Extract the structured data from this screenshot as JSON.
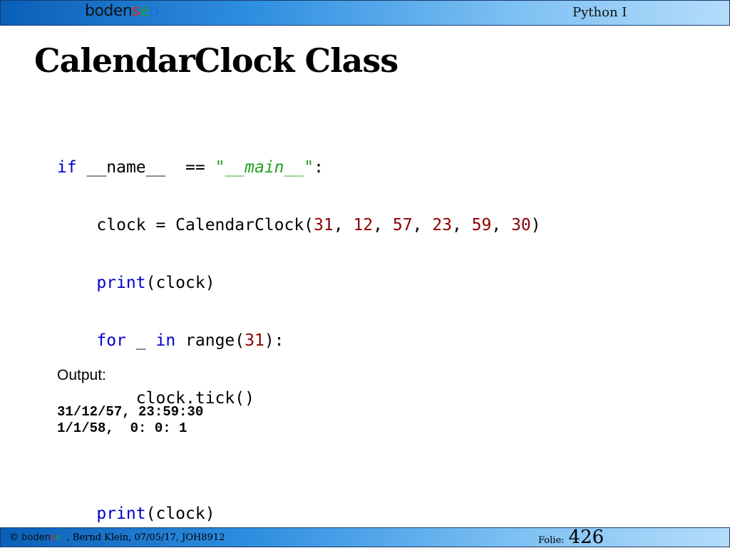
{
  "header": {
    "logo": {
      "part1": "boden",
      "part2": "s",
      "part3": "e",
      "part4": "o"
    },
    "course_title": "Python I"
  },
  "slide": {
    "title": "CalendarClock Class"
  },
  "code": {
    "line1": {
      "kw_if": "if",
      "name": " __name__  ",
      "eq": "== ",
      "q1": "\"",
      "main": "__main__",
      "q2": "\"",
      "colon": ":"
    },
    "line2": {
      "indent": "    ",
      "pre": "clock = CalendarClock(",
      "n1": "31",
      "c1": ", ",
      "n2": "12",
      "c2": ", ",
      "n3": "57",
      "c3": ", ",
      "n4": "23",
      "c4": ", ",
      "n5": "59",
      "c5": ", ",
      "n6": "30",
      "close": ")"
    },
    "line3": {
      "indent": "    ",
      "kw_print": "print",
      "rest": "(clock)"
    },
    "line4": {
      "indent": "    ",
      "kw_for": "for",
      "mid": " _ ",
      "kw_in": "in",
      "range": " range(",
      "n": "31",
      "close": "):"
    },
    "line5": {
      "indent": "        ",
      "text": "clock.tick()"
    },
    "line7": {
      "indent": "    ",
      "kw_print": "print",
      "rest": "(clock)"
    }
  },
  "output": {
    "label": "Output:",
    "lines": [
      "31/12/57, 23:59:30",
      "1/1/58,  0: 0: 1"
    ]
  },
  "footer": {
    "copyright": "© ",
    "logo": {
      "part1": "boden",
      "part2": "s",
      "part3": "e",
      "part4": "o"
    },
    "author_info": ", Bernd Klein, 07/05/17, JOH8912",
    "folie_label": "Folie:",
    "folie_number": "426"
  },
  "colors": {
    "bar_gradient_start": "#0a5fb8",
    "bar_gradient_end": "#b4dcfb",
    "keyword": "#0000cc",
    "number": "#8b0000",
    "string": "#22a022"
  }
}
